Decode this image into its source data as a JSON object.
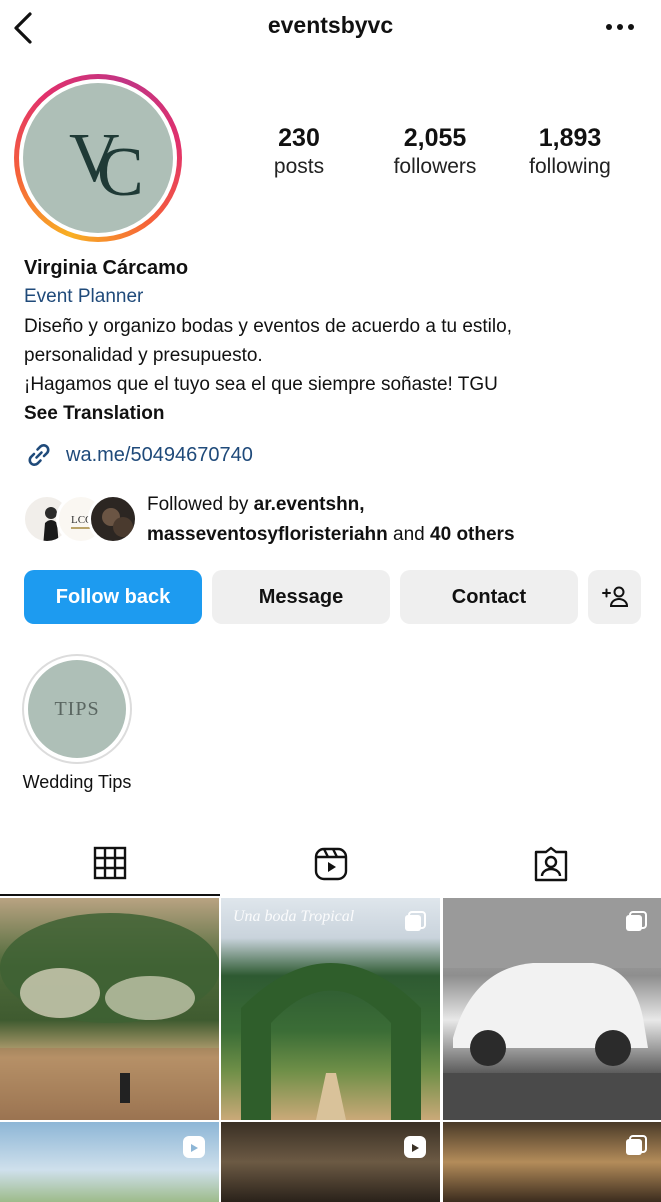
{
  "header": {
    "username": "eventsbyvc"
  },
  "profile": {
    "avatar_initials": "VC",
    "stats": {
      "posts_count": "230",
      "posts_label": "posts",
      "followers_count": "2,055",
      "followers_label": "followers",
      "following_count": "1,893",
      "following_label": "following"
    },
    "name": "Virginia Cárcamo",
    "category": "Event Planner",
    "bio_lines": [
      "Diseño y organizo bodas y eventos de acuerdo a tu estilo,",
      "personalidad y presupuesto.",
      "¡Hagamos que el tuyo sea el que siempre soñaste! TGU"
    ],
    "see_translation": "See Translation",
    "link": "wa.me/50494670740"
  },
  "followed_by": {
    "prefix": "Followed by",
    "user1": "ar.eventshn,",
    "user2": "masseventosyfloristeriahn",
    "middle": "and",
    "others": "40 others"
  },
  "buttons": {
    "follow_back": "Follow back",
    "message": "Message",
    "contact": "Contact"
  },
  "highlights": [
    {
      "cover_text": "TIPS",
      "label": "Wedding Tips"
    }
  ],
  "tabs": [
    "grid-icon",
    "reels-icon",
    "tagged-icon"
  ],
  "grid": {
    "cells": [
      {
        "type": "post",
        "overlay_text": ""
      },
      {
        "type": "carousel",
        "overlay_text": "Una boda Tropical"
      },
      {
        "type": "carousel",
        "overlay_text": ""
      },
      {
        "type": "reel",
        "overlay_text": ""
      },
      {
        "type": "reel",
        "overlay_text": ""
      },
      {
        "type": "carousel",
        "overlay_text": ""
      }
    ]
  },
  "colors": {
    "accent_blue": "#1d9bf0",
    "link_blue": "#1f4a7a",
    "avatar_bg": "#aebfb7",
    "button_gray": "#efefef"
  }
}
